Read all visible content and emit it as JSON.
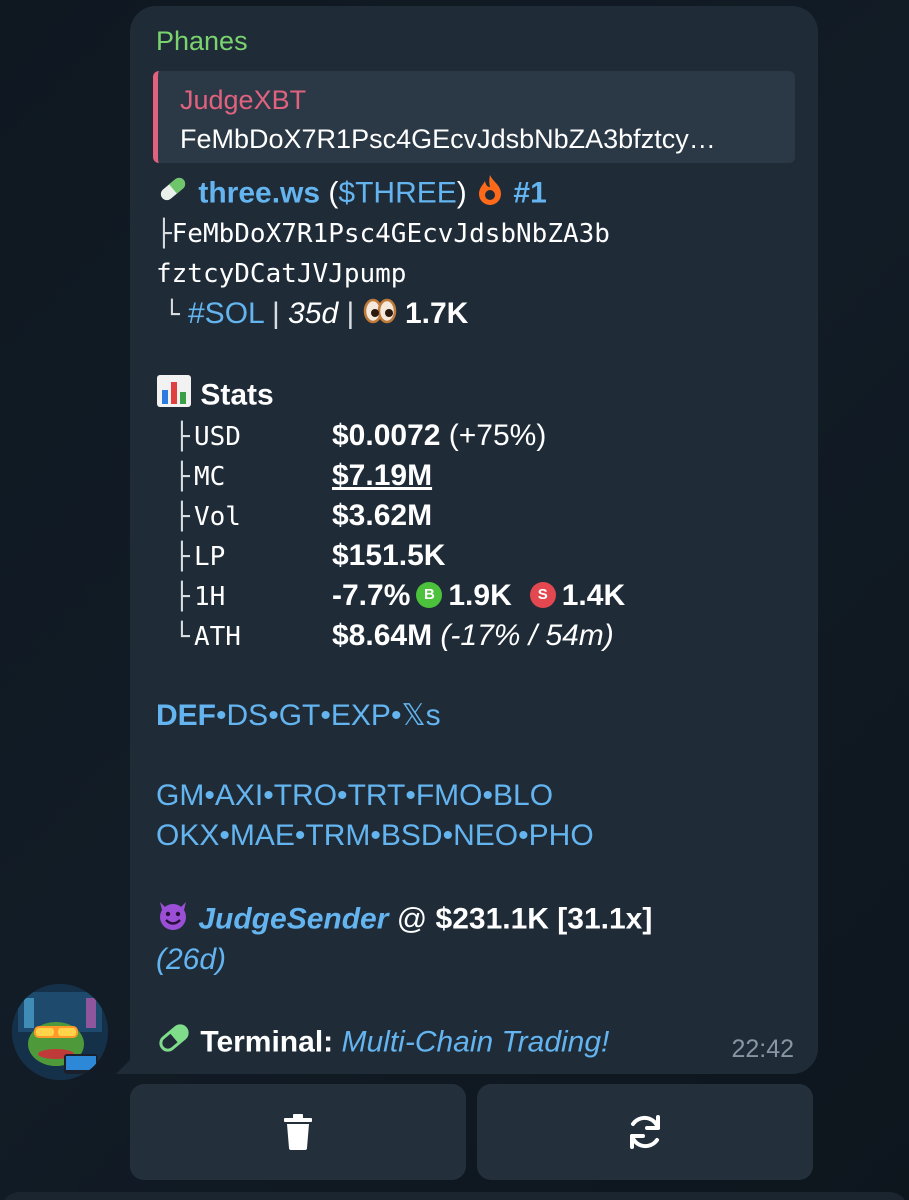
{
  "message": {
    "sender": "Phanes",
    "reply": {
      "name": "JudgeXBT",
      "text": "FeMbDoX7R1Psc4GEcvJdsbNbZA3bfztcy…"
    },
    "token_name": "three.ws",
    "token_symbol_open": " (",
    "token_symbol": "$THREE",
    "token_symbol_close": ") ",
    "rank": "#1",
    "address_prefix": "├",
    "address_line1": "FeMbDoX7R1Psc4GEcvJdsbNbZA3b",
    "address_line2": "fztcyDCatJVJpump",
    "meta_prefix": "└",
    "chain": "#SOL",
    "sep": " | ",
    "age": "35d",
    "views": "1.7K",
    "stats_title": "Stats",
    "stats": {
      "usd_key": "USD",
      "usd_val": "$0.0072",
      "usd_change": " (+75%)",
      "mc_key": "MC",
      "mc_val": "$7.19M",
      "vol_key": "Vol",
      "vol_val": "$3.62M",
      "lp_key": "LP",
      "lp_val": "$151.5K",
      "h1_key": "1H",
      "h1_change": "-7.7%",
      "buy_badge": "B",
      "buys": "1.9K",
      "sell_badge": "S",
      "sells": "1.4K",
      "ath_key": "ATH",
      "ath_val": "$8.64M",
      "ath_note": " (-17% / 54m)",
      "tree_mid": "├",
      "tree_end": "└"
    },
    "links1": {
      "def": "DEF",
      "ds": "DS",
      "gt": "GT",
      "exp": "EXP",
      "xs": "𝕏s",
      "dot": "•"
    },
    "links2": [
      "GM",
      "AXI",
      "TRO",
      "TRT",
      "FMO",
      "BLO"
    ],
    "links3": [
      "OKX",
      "MAE",
      "TRM",
      "BSD",
      "NEO",
      "PHO"
    ],
    "dev_name": "JudgeSender",
    "dev_at": " @ ",
    "dev_price": "$231.1K [31.1x]",
    "dev_age": "(26d)",
    "terminal_label": "Terminal:",
    "terminal_link": "Multi-Chain Trading!",
    "time": "22:42"
  },
  "colors": {
    "bubble": "#1f2c38",
    "link": "#64b4f0",
    "sender": "#7bd36f",
    "reply_accent": "#e1627f",
    "buy": "#4cc13c",
    "sell": "#e3474f"
  },
  "buttons": {
    "delete_icon": "trash-icon",
    "refresh_icon": "refresh-icon"
  }
}
